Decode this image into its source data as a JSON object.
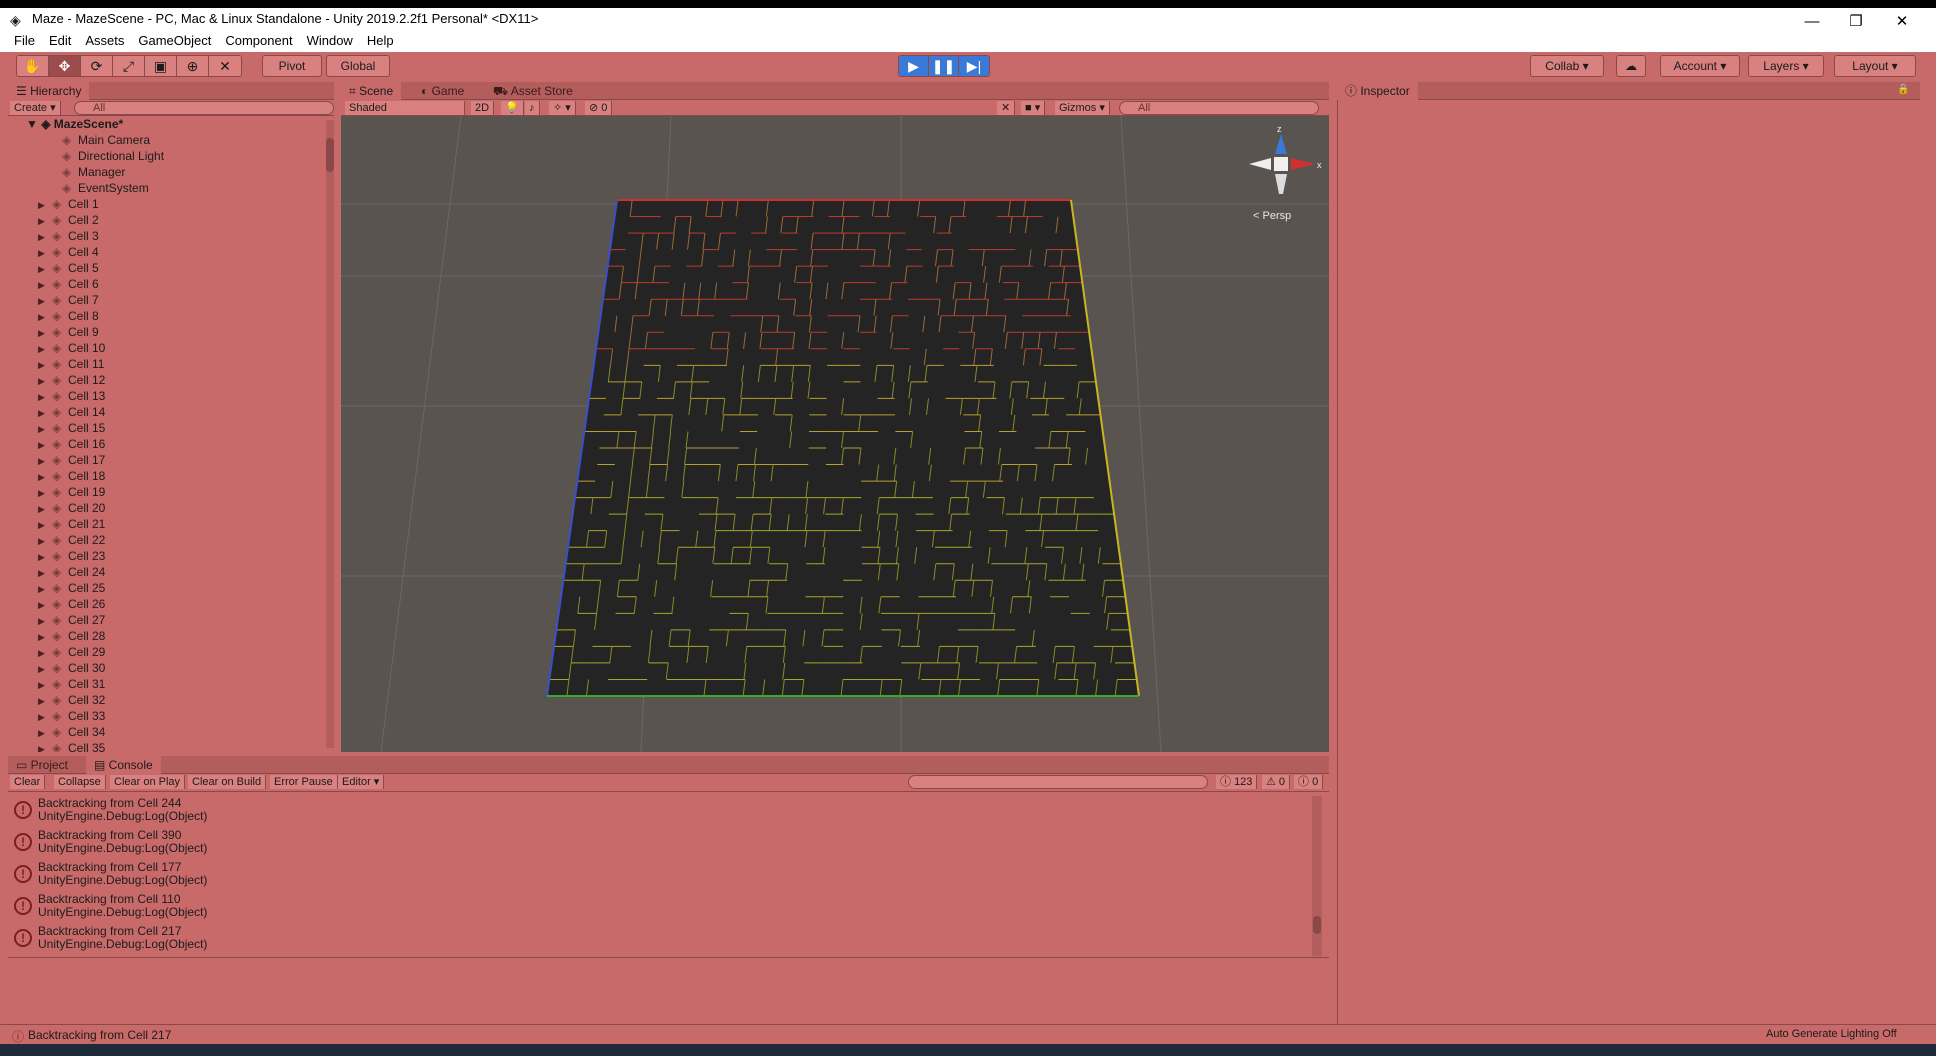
{
  "window": {
    "title": "Maze - MazeScene - PC, Mac & Linux Standalone - Unity 2019.2.2f1 Personal* <DX11>",
    "minimize": "—",
    "restore": "❐",
    "close": "✕"
  },
  "menu": [
    "File",
    "Edit",
    "Assets",
    "GameObject",
    "Component",
    "Window",
    "Help"
  ],
  "toolbar": {
    "pivot": "Pivot",
    "global": "Global",
    "collab": "Collab ▾",
    "account": "Account",
    "layers": "Layers",
    "layout": "Layout"
  },
  "hierarchy": {
    "tab": "Hierarchy",
    "create": "Create ▾",
    "search_placeholder": "All",
    "scene": "MazeScene*",
    "items": [
      "Main Camera",
      "Directional Light",
      "Manager",
      "EventSystem",
      "Cell 1",
      "Cell 2",
      "Cell 3",
      "Cell 4",
      "Cell 5",
      "Cell 6",
      "Cell 7",
      "Cell 8",
      "Cell 9",
      "Cell 10",
      "Cell 11",
      "Cell 12",
      "Cell 13",
      "Cell 14",
      "Cell 15",
      "Cell 16",
      "Cell 17",
      "Cell 18",
      "Cell 19",
      "Cell 20",
      "Cell 21",
      "Cell 22",
      "Cell 23",
      "Cell 24",
      "Cell 25",
      "Cell 26",
      "Cell 27",
      "Cell 28",
      "Cell 29",
      "Cell 30",
      "Cell 31",
      "Cell 32",
      "Cell 33",
      "Cell 34",
      "Cell 35"
    ]
  },
  "scene": {
    "tabs": [
      "Scene",
      "Game",
      "Asset Store"
    ],
    "shading": "Shaded",
    "mode2d": "2D",
    "gizmos": "Gizmos ▾",
    "search_placeholder": "All",
    "layer_count": "0",
    "gizmo_axes": {
      "x": "x",
      "z": "z"
    },
    "persp": "Persp"
  },
  "inspector": {
    "tab": "Inspector"
  },
  "console": {
    "tabs": [
      "Project",
      "Console"
    ],
    "buttons": [
      "Clear",
      "Collapse",
      "Clear on Play",
      "Clear on Build",
      "Error Pause",
      "Editor ▾"
    ],
    "counts": {
      "errors": "123",
      "warnings": "0",
      "messages": "0"
    },
    "logs": [
      {
        "msg": "Backtracking from Cell 244",
        "src": "UnityEngine.Debug:Log(Object)"
      },
      {
        "msg": "Backtracking from Cell 390",
        "src": "UnityEngine.Debug:Log(Object)"
      },
      {
        "msg": "Backtracking from Cell 177",
        "src": "UnityEngine.Debug:Log(Object)"
      },
      {
        "msg": "Backtracking from Cell 110",
        "src": "UnityEngine.Debug:Log(Object)"
      },
      {
        "msg": "Backtracking from Cell 217",
        "src": "UnityEngine.Debug:Log(Object)"
      }
    ]
  },
  "status": {
    "message": "Backtracking from Cell 217",
    "lighting": "Auto Generate Lighting Off"
  },
  "colors": {
    "panel": "#c96a6a",
    "tabbar": "#b45d5d",
    "scene_bg": "#5a5450",
    "maze_floor": "#222",
    "play_blue": "#3b79d6"
  }
}
